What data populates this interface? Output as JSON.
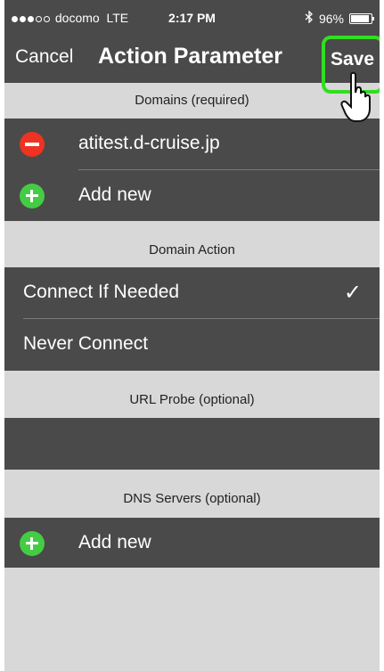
{
  "status_bar": {
    "carrier": "docomo",
    "network": "LTE",
    "time": "2:17 PM",
    "battery": "96%",
    "battery_level": 0.96
  },
  "nav": {
    "cancel_label": "Cancel",
    "title": "Action Parameter",
    "save_label": "Save"
  },
  "sections": {
    "domains": {
      "header": "Domains (required)",
      "items": [
        "atitest.d-cruise.jp"
      ],
      "add_label": "Add new"
    },
    "domain_action": {
      "header": "Domain Action",
      "options": [
        "Connect If Needed",
        "Never Connect"
      ],
      "selected": "Connect If Needed",
      "check": "✓"
    },
    "url_probe": {
      "header": "URL Probe (optional)",
      "value": ""
    },
    "dns_servers": {
      "header": "DNS Servers (optional)",
      "add_label": "Add new"
    }
  },
  "colors": {
    "bar": "#4a4a4a",
    "background": "#d8d8d8",
    "highlight": "#33dd22",
    "delete": "#ee3322",
    "add": "#44cc44"
  }
}
